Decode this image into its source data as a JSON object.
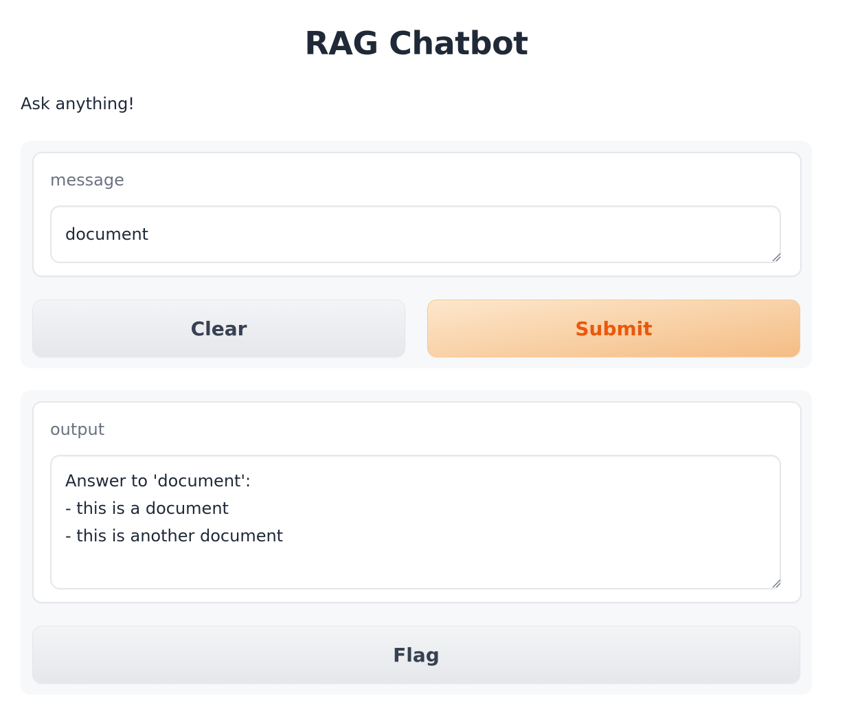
{
  "app": {
    "title": "RAG Chatbot",
    "description": "Ask anything!"
  },
  "input": {
    "label": "message",
    "value": "document"
  },
  "buttons": {
    "clear_label": "Clear",
    "submit_label": "Submit",
    "flag_label": "Flag"
  },
  "output": {
    "label": "output",
    "value": "Answer to 'document':\n- this is a document\n- this is another document"
  },
  "colors": {
    "primary_text": "#ea580c",
    "primary_bg_start": "#fde7cc",
    "primary_bg_end": "#f4bd85",
    "secondary_bg": "#e5e7eb",
    "panel_bg": "#f7f8fa"
  },
  "icons": {
    "resize": "resize-handle-icon"
  }
}
